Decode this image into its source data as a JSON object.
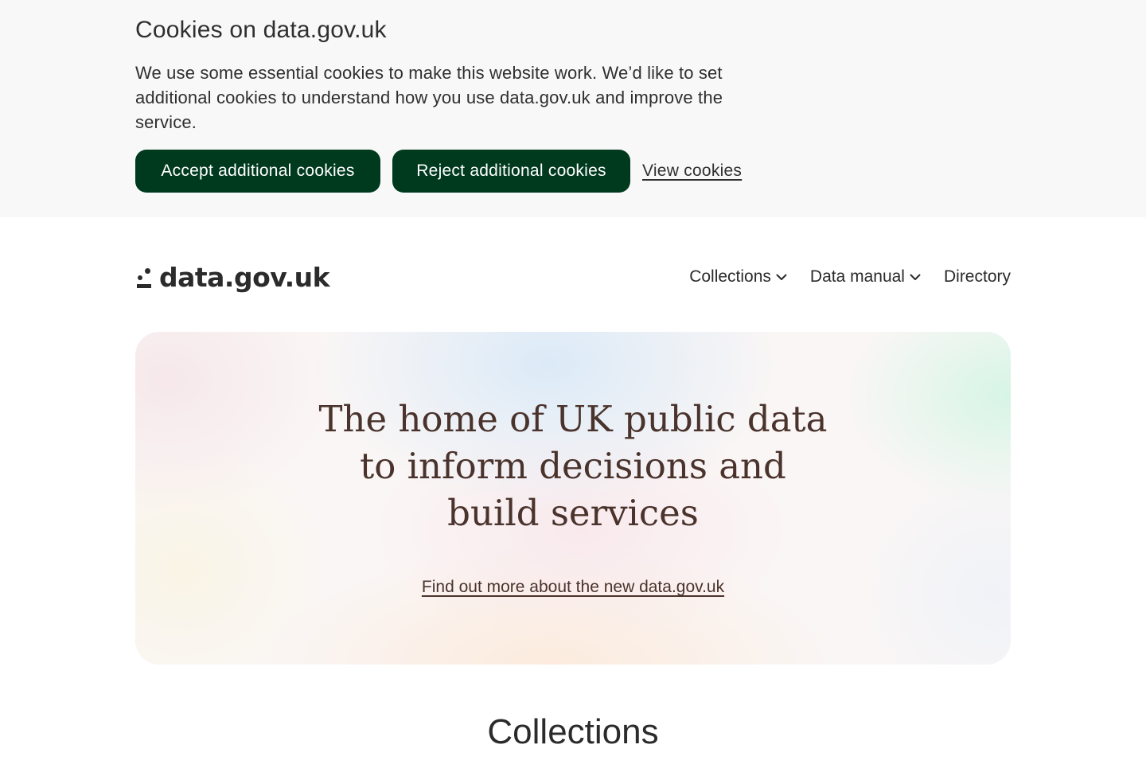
{
  "cookie_banner": {
    "title": "Cookies on data.gov.uk",
    "text": "We use some essential cookies to make this website work. We’d like to set additional cookies to understand how you use data.gov.uk and improve the service.",
    "accept_label": "Accept additional cookies",
    "reject_label": "Reject additional cookies",
    "view_label": "View cookies"
  },
  "header": {
    "logo_text": "data.gov.uk",
    "nav": [
      {
        "label": "Collections",
        "icon": "chevron-down-icon"
      },
      {
        "label": "Data manual",
        "icon": "chevron-down-icon"
      },
      {
        "label": "Directory"
      }
    ]
  },
  "hero": {
    "title": "The home of UK public data to inform decisions and build services",
    "link_text": "Find out more about the new data.gov.uk"
  },
  "collections": {
    "heading": "Collections"
  },
  "colors": {
    "button_bg": "#003a1e",
    "banner_bg": "#f8f8f8",
    "hero_text": "#4a332c",
    "text": "#2b2b2b"
  }
}
